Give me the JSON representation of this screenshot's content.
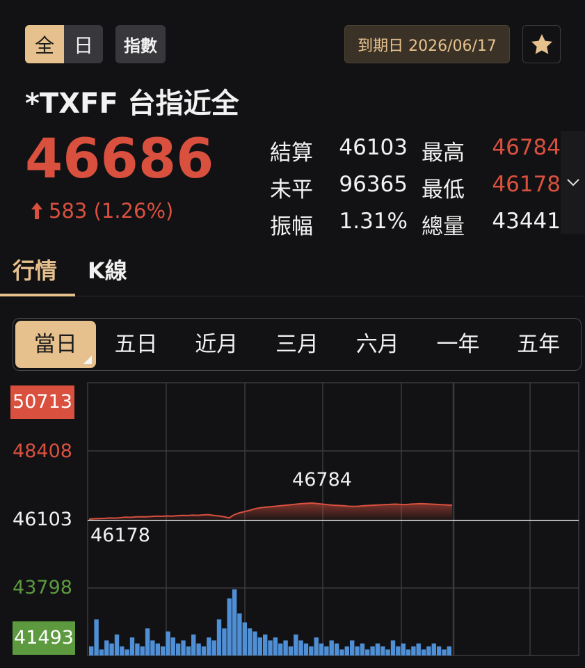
{
  "header": {
    "mode_all": "全",
    "mode_day": "日",
    "index_label": "指數",
    "expiry": "到期日 2026/06/17",
    "favorite_icon": "star-icon"
  },
  "instrument": {
    "name": "*TXFF 台指近全",
    "price": "46686",
    "change": "583 (1.26%)",
    "change_icon": "arrow-up-icon",
    "up_color": "#d9503f"
  },
  "stats": [
    {
      "k1": "結算",
      "v1": "46103",
      "k2": "最高",
      "v2": "46784"
    },
    {
      "k1": "未平",
      "v1": "96365",
      "k2": "最低",
      "v2": "46178"
    },
    {
      "k1": "振幅",
      "v1": "1.31%",
      "k2": "總量",
      "v2": "43441"
    }
  ],
  "tabs": [
    "行情",
    "K線"
  ],
  "periods": [
    "當日",
    "五日",
    "近月",
    "三月",
    "六月",
    "一年",
    "五年"
  ],
  "chart_data": {
    "type": "line",
    "ylim": [
      41493,
      50713
    ],
    "y_ticks": [
      "50713",
      "48408",
      "46103",
      "43798",
      "41493"
    ],
    "reference": 46103,
    "annotations": {
      "high": "46784",
      "low": "46178"
    },
    "series": [
      {
        "values": [
          46155,
          46170,
          46178,
          46185,
          46200,
          46195,
          46210,
          46230,
          46225,
          46240,
          46250,
          46245,
          46260,
          46270,
          46265,
          46280,
          46275,
          46290,
          46300,
          46295,
          46310,
          46305,
          46320,
          46330,
          46300,
          46280,
          46250,
          46200,
          46330,
          46400,
          46450,
          46500,
          46560,
          46600,
          46620,
          46640,
          46660,
          46680,
          46700,
          46720,
          46740,
          46760,
          46770,
          46784,
          46760,
          46740,
          46720,
          46700,
          46690,
          46680,
          46660,
          46650,
          46660,
          46680,
          46690,
          46700,
          46710,
          46720,
          46730,
          46740,
          46730,
          46720,
          46740,
          46750,
          46760,
          46750,
          46740,
          46730,
          46720,
          46710,
          46700
        ]
      }
    ],
    "volume": [
      3,
      12,
      2,
      5,
      4,
      7,
      3,
      2,
      6,
      4,
      3,
      9,
      5,
      4,
      3,
      8,
      6,
      4,
      5,
      3,
      7,
      4,
      3,
      6,
      5,
      12,
      9,
      19,
      22,
      14,
      11,
      9,
      8,
      6,
      7,
      5,
      6,
      4,
      5,
      3,
      7,
      5,
      4,
      3,
      6,
      4,
      3,
      5,
      4,
      2,
      3,
      5,
      3,
      4,
      2,
      3,
      4,
      3,
      2,
      5,
      3,
      4,
      2,
      3,
      4,
      2,
      3,
      4,
      3,
      2,
      3
    ],
    "colors": {
      "line": "#d9503f",
      "volume": "#4f8fd6",
      "grid": "#3a3a3e"
    }
  }
}
